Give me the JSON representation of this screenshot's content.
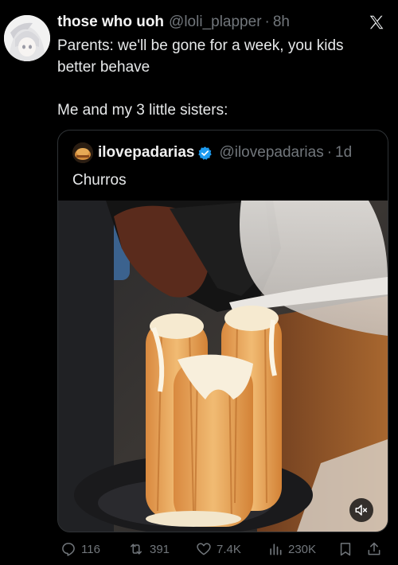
{
  "tweet": {
    "author_name": "those who uoh",
    "author_handle": "@loli_plapper",
    "separator": "·",
    "time": "8h",
    "text": "Parents: we'll be gone for a week, you kids better behave\n\nMe and my 3 little sisters:"
  },
  "quoted_tweet": {
    "author_name": "ilovepadarias",
    "author_handle": "@ilovepadarias",
    "separator": "·",
    "time": "1d",
    "text": "Churros"
  },
  "actions": {
    "replies": "116",
    "reposts": "391",
    "likes": "7.4K",
    "views": "230K"
  },
  "icons": {
    "logo": "x-logo-icon",
    "verified": "verified-badge-icon",
    "mute": "mute-icon",
    "reply": "reply-icon",
    "repost": "repost-icon",
    "like": "heart-icon",
    "views": "views-icon",
    "bookmark": "bookmark-icon",
    "share": "share-icon"
  },
  "colors": {
    "background": "#000000",
    "text": "#e7e9ea",
    "muted": "#71767b",
    "verified": "#1d9bf0"
  }
}
